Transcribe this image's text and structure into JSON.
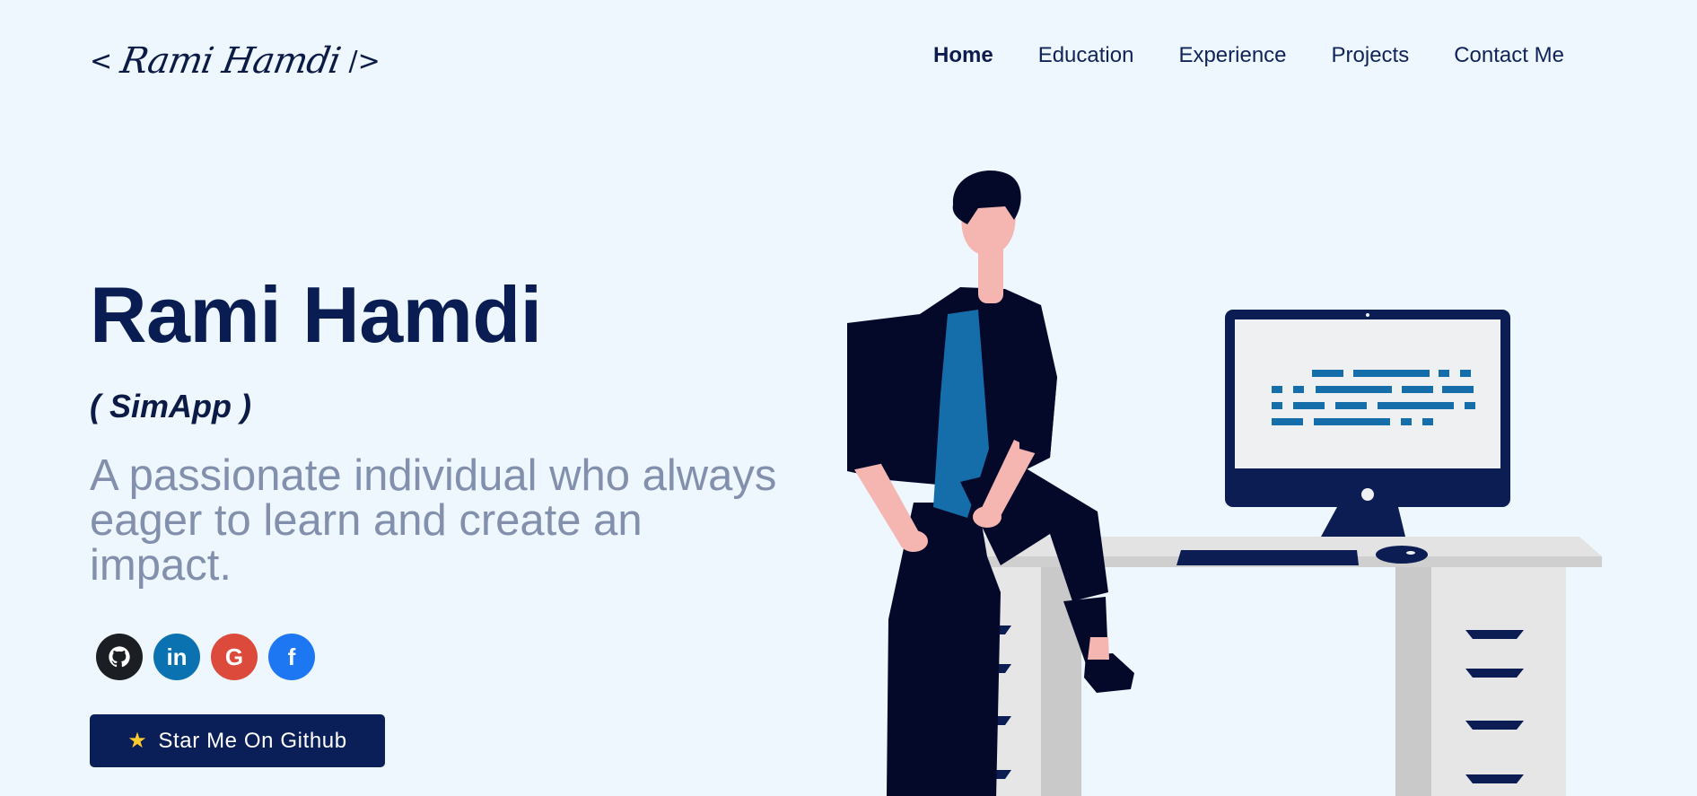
{
  "logo": {
    "open": "<",
    "signature": "Rami Hamdi",
    "close": "/>"
  },
  "nav": {
    "items": [
      {
        "label": "Home",
        "active": true
      },
      {
        "label": "Education",
        "active": false
      },
      {
        "label": "Experience",
        "active": false
      },
      {
        "label": "Projects",
        "active": false
      },
      {
        "label": "Contact Me",
        "active": false
      }
    ]
  },
  "hero": {
    "name": "Rami Hamdi",
    "nickname": "( SimApp )",
    "tagline": "A passionate individual who always eager to learn and create an impact."
  },
  "socials": [
    {
      "icon": "github-icon",
      "color": "#1b1f23"
    },
    {
      "icon": "linkedin-icon",
      "color": "#0a72b1",
      "glyph": "in"
    },
    {
      "icon": "google-icon",
      "color": "#dc4a3b",
      "glyph": "G"
    },
    {
      "icon": "facebook-icon",
      "color": "#1d77f2",
      "glyph": "f"
    }
  ],
  "cta": {
    "icon": "star-icon",
    "label": "Star Me On Github"
  },
  "colors": {
    "background": "#edf7fd",
    "primary": "#0a1e57",
    "tagline": "#8290ad",
    "accent_blue": "#156ea9"
  }
}
